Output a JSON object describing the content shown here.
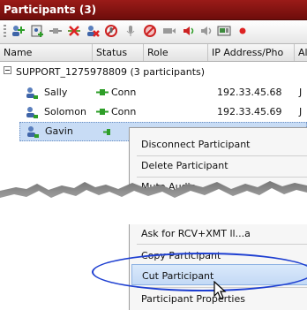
{
  "window": {
    "title": "Participants (3)"
  },
  "toolbar": {
    "icons": [
      "add-participant-icon",
      "add-from-address-book-icon",
      "connect-icon",
      "disconnect-icon",
      "delete-icon",
      "mute-icon",
      "mute-audio-icon",
      "block-icon",
      "video-icon",
      "audio-out-icon",
      "audio-in-icon",
      "camera-icon",
      "record-icon"
    ]
  },
  "columns": [
    "Name",
    "Status",
    "Role",
    "IP Address/Pho",
    "Al"
  ],
  "group": {
    "label": "SUPPORT_1275978809 (3 participants)"
  },
  "participants": [
    {
      "name": "Sally",
      "status": "Conn",
      "ip": "192.33.45.68",
      "extra": "J"
    },
    {
      "name": "Solomon",
      "status": "Conn",
      "ip": "192.33.45.69",
      "extra": "J"
    },
    {
      "name": "Gavin",
      "status": "",
      "ip": "",
      "extra": ""
    }
  ],
  "context_menu": {
    "items": [
      "Disconnect Participant",
      "Delete Participant",
      "Mute Audio",
      "Ask for RCV+XMT ll...a",
      "Copy Participant",
      "Cut Participant",
      "Participant Properties"
    ],
    "highlighted_index": 5
  },
  "colors": {
    "titlebar": "#8a1512",
    "highlight_ellipse": "#1e3fd1",
    "selection": "#c8dcf5",
    "status_green": "#2e9e28"
  }
}
